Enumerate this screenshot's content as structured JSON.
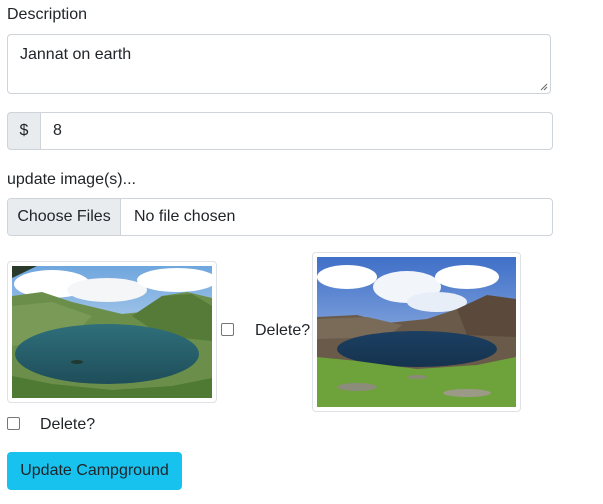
{
  "form": {
    "description_label": "Description",
    "description_value": "Jannat on earth",
    "price_prefix": "$",
    "price_value": "8",
    "images_label": "update image(s)...",
    "file_button_label": "Choose Files",
    "file_status": "No file chosen",
    "images": [
      {
        "delete_label": "Delete?",
        "checked": false
      },
      {
        "delete_label": "Delete?",
        "checked": false
      }
    ],
    "submit_label": "Update Campground"
  },
  "colors": {
    "submit_bg": "#17c2ee",
    "addon_bg": "#e9ecef",
    "border": "#ced4da"
  }
}
